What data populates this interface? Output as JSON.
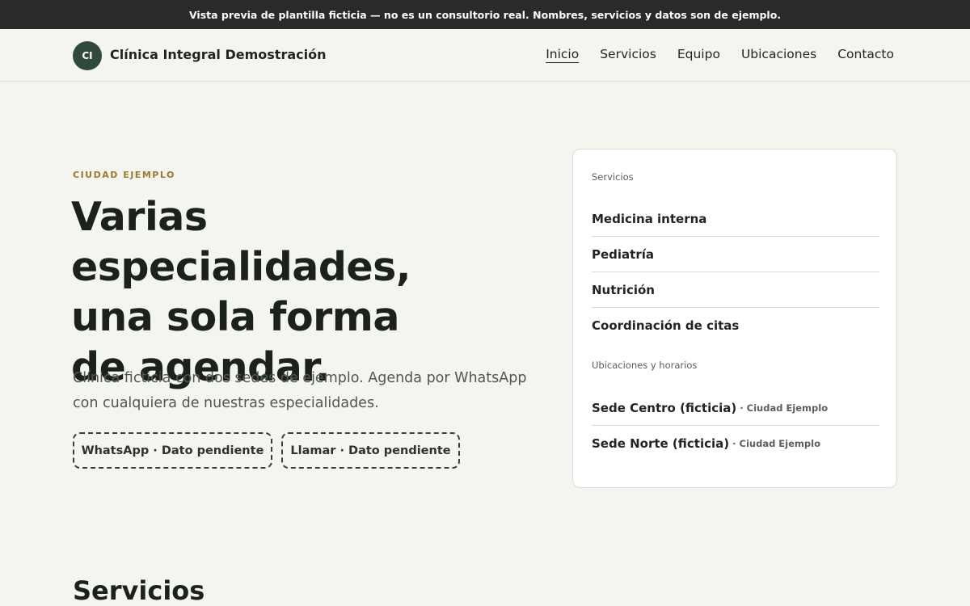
{
  "notice": "Vista previa de plantilla ficticia — no es un consultorio real. Nombres, servicios y datos son de ejemplo.",
  "header": {
    "logo_initials": "CI",
    "brand": "Clínica Integral Demostración",
    "nav": [
      "Inicio",
      "Servicios",
      "Equipo",
      "Ubicaciones",
      "Contacto"
    ],
    "active_nav": "Inicio"
  },
  "hero": {
    "eyebrow": "CIUDAD EJEMPLO",
    "title_lines": [
      "Varias especialidades,",
      "una sola forma",
      "de agendar."
    ],
    "description": "Clínica ficticia con dos sedes de ejemplo. Agenda por WhatsApp con cualquiera de nuestras especialidades.",
    "whatsapp_button": "WhatsApp · Dato pendiente",
    "call_button": "Llamar · Dato pendiente"
  },
  "card": {
    "services_label": "Servicios",
    "services": [
      "Medicina interna",
      "Pediatría",
      "Nutrición",
      "Coordinación de citas"
    ],
    "locations_label": "Ubicaciones y horarios",
    "locations": [
      {
        "name": "Sede Centro (ficticia)",
        "city": "Ciudad Ejemplo"
      },
      {
        "name": "Sede Norte (ficticia)",
        "city": "Ciudad Ejemplo"
      }
    ]
  },
  "sections": {
    "services_title": "Servicios"
  },
  "colors": {
    "topbar": "#2a2a2a",
    "background": "#f5f5f0",
    "brand_green": "#2f4a3a",
    "eyebrow_gold": "#9a7a32"
  }
}
